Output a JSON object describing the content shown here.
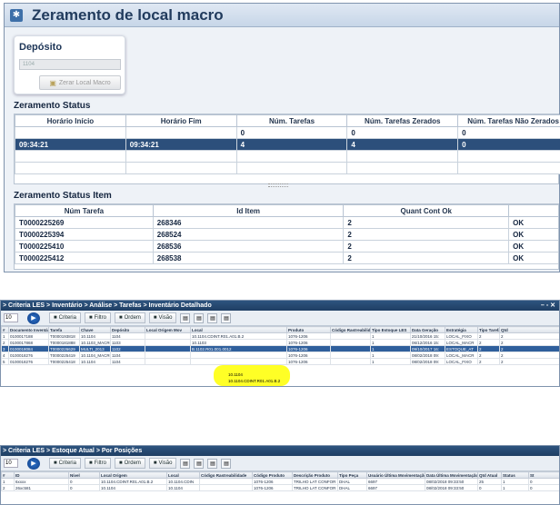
{
  "panel1": {
    "title": "Zeramento de local macro",
    "deposito_label": "Depósito",
    "deposito_value": "1104",
    "zerar_button": "Zerar Local Macro",
    "status_title": "Zeramento Status",
    "status_headers": [
      "Horário Início",
      "Horário Fim",
      "Núm. Tarefas",
      "Núm. Tarefas Zerados",
      "Núm. Tarefas Não Zerados"
    ],
    "status_rows": [
      [
        "",
        "",
        "0",
        "0",
        "0"
      ],
      [
        "09:34:21",
        "09:34:21",
        "4",
        "4",
        "0"
      ]
    ],
    "item_title": "Zeramento Status Item",
    "item_headers": [
      "Núm Tarefa",
      "Id Item",
      "Quant Cont Ok",
      ""
    ],
    "item_rows": [
      [
        "T0000225269",
        "268346",
        "2",
        "OK"
      ],
      [
        "T0000225394",
        "268524",
        "2",
        "OK"
      ],
      [
        "T0000225410",
        "268536",
        "2",
        "OK"
      ],
      [
        "T0000225412",
        "268538",
        "2",
        "OK"
      ]
    ]
  },
  "panel2": {
    "breadcrumb": "> Criteria LES > Inventário > Análise > Tarefas > Inventário Detalhado",
    "page_size": "10",
    "toolbar": [
      "Criteria",
      "Filtro",
      "Ordem",
      "Visão"
    ],
    "headers": [
      "#",
      "Documento Inventário",
      "Tarefa",
      "Chave",
      "Depósito",
      "Local Origem Mov",
      "Local",
      "Produto",
      "Código Rastreabilidade",
      "Tipo Estoque LES",
      "Data Geração",
      "Estratégia",
      "Tipo Tarefa",
      "Qtd"
    ],
    "rows": [
      [
        "1",
        "0100017188",
        "T0000193818",
        "10.1104",
        "1104",
        "",
        "10.1104.CDINT.R01.A01.B.2",
        "1076-1206",
        "",
        "1",
        "21/10/2016 15:",
        "LOCAL_FIXO",
        "2",
        "2"
      ],
      [
        "2",
        "0100017868",
        "T0000181888",
        "10.1103_MACRO",
        "1103",
        "",
        "10.1103",
        "1076-1206",
        "",
        "1",
        "06/12/2016 15:",
        "LOCAL_MACR",
        "2",
        "2"
      ],
      [
        "3",
        "0100018084",
        "T0000226629",
        "MULTI_2013",
        "1102",
        "",
        "B.1102.R01.001.0012",
        "1076-1206",
        "",
        "1",
        "09/10/2017 16:",
        "ESTOQUE_AT",
        "2",
        "2"
      ],
      [
        "4",
        "0100018276",
        "T0000225419",
        "10.1104_MACRO",
        "1104",
        "",
        "10.1104",
        "1076-1206",
        "",
        "1",
        "08/02/2018 09:",
        "LOCAL_MACR",
        "2",
        "2"
      ],
      [
        "5",
        "0100018276",
        "T0000225418",
        "10.1104",
        "1104",
        "",
        "10.1104.CDINT.R01.A01.B.2",
        "1076-1206",
        "",
        "1",
        "08/02/2018 09:",
        "LOCAL_FIXO",
        "2",
        "2"
      ]
    ]
  },
  "panel3": {
    "breadcrumb": "> Criteria LES > Estoque Atual > Por Posições",
    "page_size": "10",
    "toolbar": [
      "Criteria",
      "Filtro",
      "Ordem",
      "Visão"
    ],
    "headers": [
      "#",
      "ID",
      "Nível",
      "Local Origem",
      "Local",
      "Código Rastreabilidade",
      "Código Produto",
      "Descrição Produto",
      "Tipo Peça",
      "Usuário Última Movimentação",
      "Data Última Movimentação",
      "Qtd Atual",
      "Status",
      "St"
    ],
    "rows": [
      [
        "1",
        "6xxxx",
        "0",
        "10.1104.CDINT.R01.A01.B.2",
        "10.1104.CDIN",
        "",
        "1076-1206",
        "TRILHO LAT CONFOR",
        "DHAL",
        "6697",
        "08/02/2018 09:33:50",
        "25",
        "1",
        "0"
      ],
      [
        "2",
        "26xc581",
        "0",
        "10.1104",
        "10.1104",
        "",
        "1076-1206",
        "TRILHO LAT CONFOR",
        "DHAL",
        "6697",
        "08/02/2018 09:33:50",
        "0",
        "1",
        "0"
      ]
    ]
  }
}
